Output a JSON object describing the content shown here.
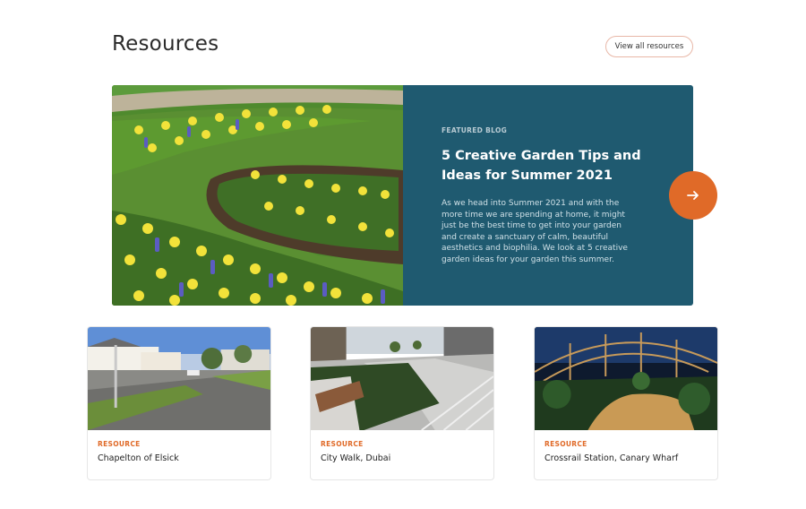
{
  "header": {
    "title": "Resources",
    "view_all_label": "View all resources"
  },
  "featured": {
    "tag": "FEATURED BLOG",
    "title": "5 Creative Garden Tips and Ideas for Summer 2021",
    "description": "As we head into Summer 2021 and with the more time we are spending at home, it might just be the best time to get into your garden and create a sanctuary of calm, beautiful aesthetics and biophilia. We look at 5 creative garden ideas for your garden this summer.",
    "arrow_icon": "arrow-right-icon"
  },
  "cards": [
    {
      "tag": "RESOURCE",
      "title": "Chapelton of Elsick"
    },
    {
      "tag": "RESOURCE",
      "title": "City Walk, Dubai"
    },
    {
      "tag": "RESOURCE",
      "title": "Crossrail Station, Canary Wharf"
    }
  ],
  "colors": {
    "accent": "#e06a28",
    "panel": "#1f5a70"
  }
}
